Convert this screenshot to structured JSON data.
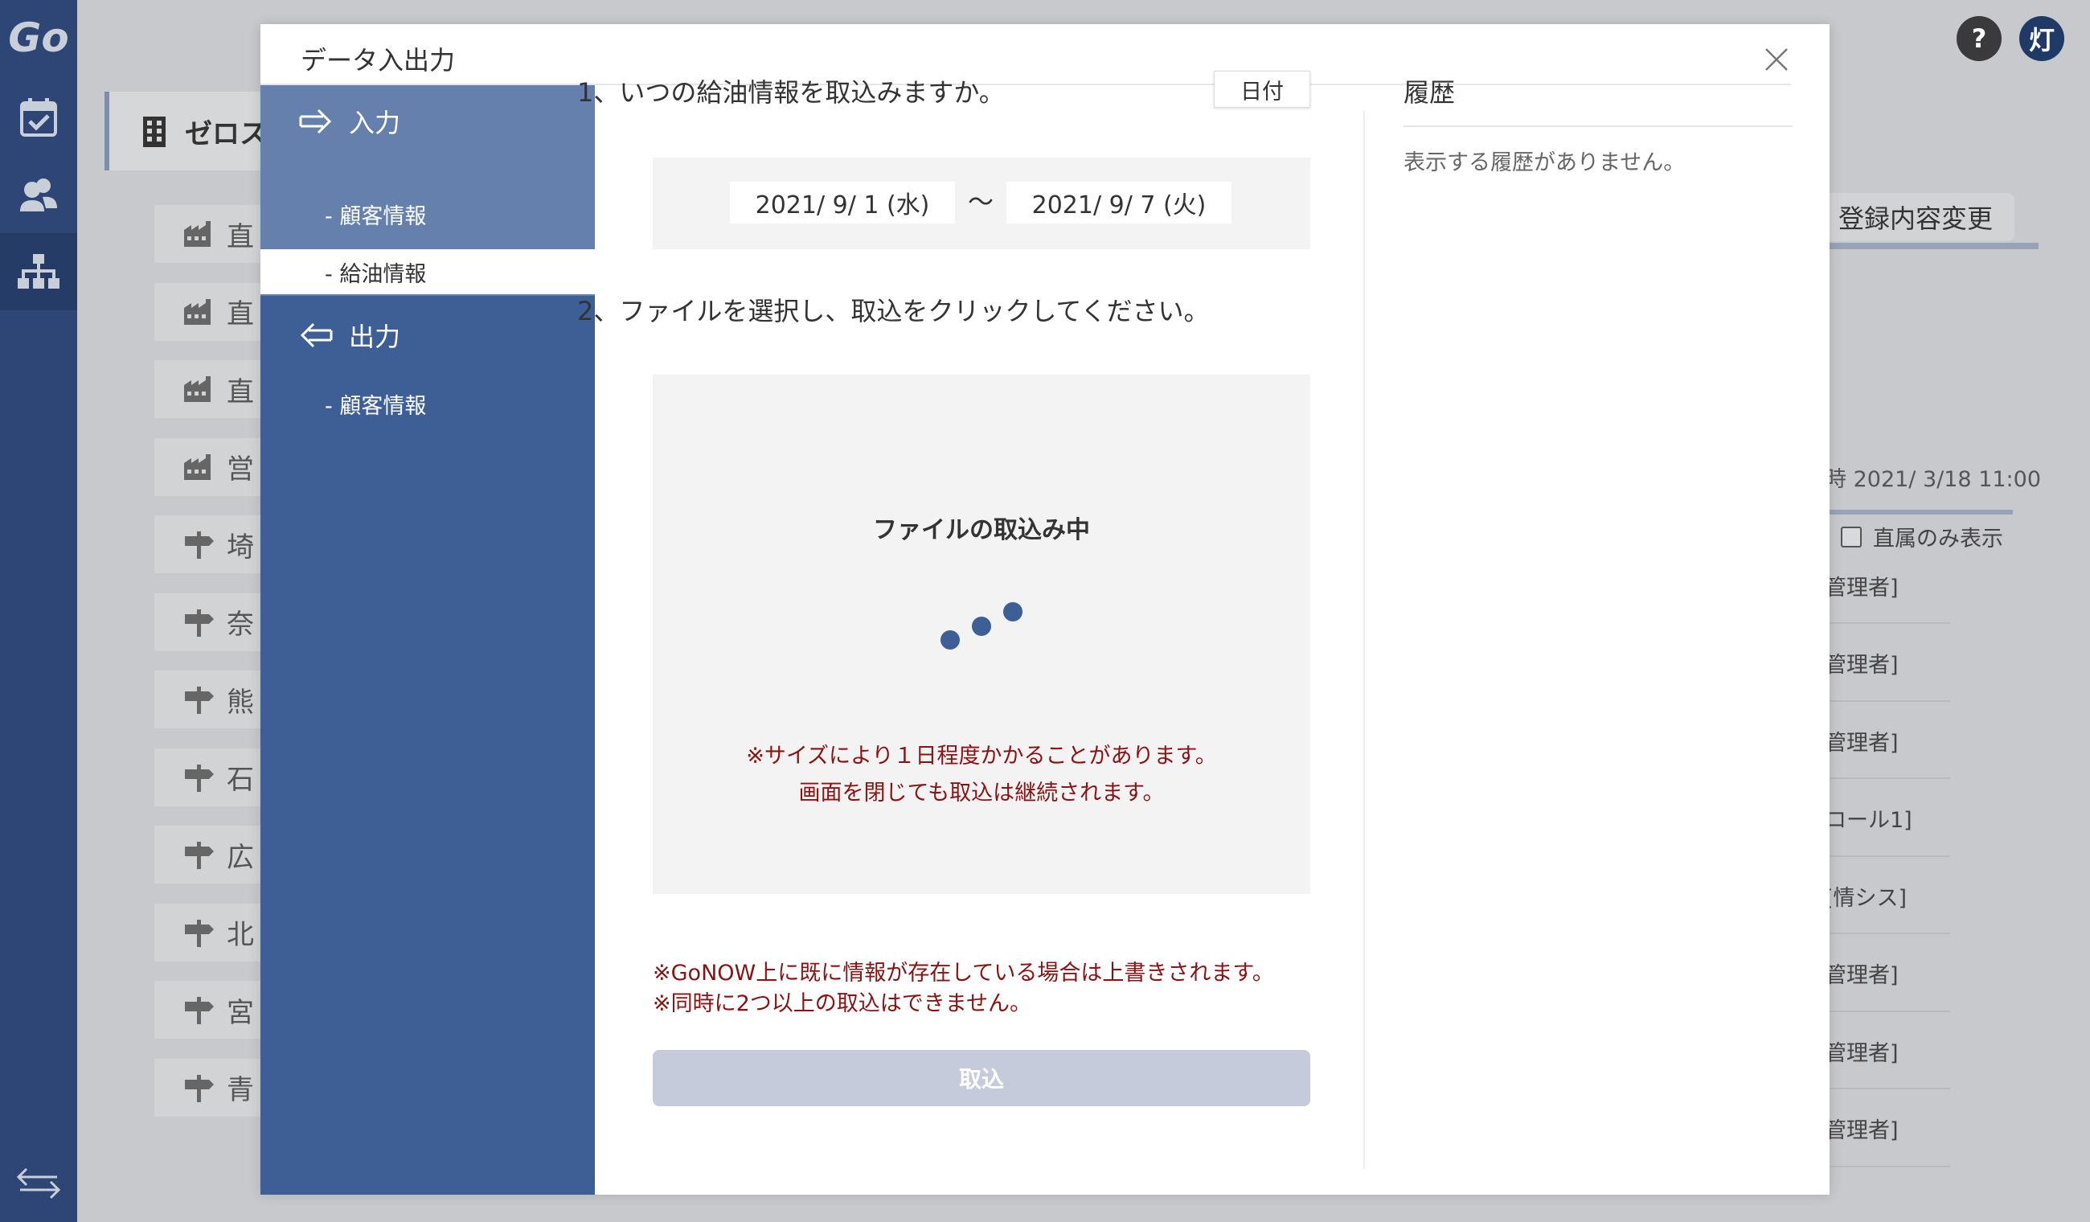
{
  "app": {
    "logo": "Go",
    "header_help": "?",
    "header_user_initial": "灯"
  },
  "background": {
    "org_title": "ゼロス",
    "org_rows": [
      {
        "icon": "factory-icon",
        "label": "直"
      },
      {
        "icon": "factory-icon",
        "label": "直"
      },
      {
        "icon": "factory-icon",
        "label": "直"
      },
      {
        "icon": "factory-icon",
        "label": "営"
      },
      {
        "icon": "signpost-icon",
        "label": "埼"
      },
      {
        "icon": "signpost-icon",
        "label": "奈"
      },
      {
        "icon": "signpost-icon",
        "label": "熊"
      },
      {
        "icon": "signpost-icon",
        "label": "石"
      },
      {
        "icon": "signpost-icon",
        "label": "広"
      },
      {
        "icon": "signpost-icon",
        "label": "北"
      },
      {
        "icon": "signpost-icon",
        "label": "宮"
      },
      {
        "icon": "signpost-icon",
        "label": "青"
      }
    ],
    "edit_button": "登録内容変更",
    "timestamp": "時 2021/ 3/18 11:00",
    "direct_only_label": "直属のみ表示",
    "roles": [
      "管理者]",
      "管理者]",
      "管理者]",
      "ロール1]",
      "[情シス]",
      "管理者]",
      "管理者]",
      "管理者]"
    ]
  },
  "modal": {
    "title": "データ入出力",
    "nav": {
      "input_label": "入力",
      "input_items": [
        "- 顧客情報",
        "- 給油情報"
      ],
      "output_label": "出力",
      "output_items": [
        "- 顧客情報"
      ]
    },
    "step1": "1、いつの給油情報を取込みますか。",
    "date_type_button": "日付",
    "date_from": "2021/ 9/ 1 (水)",
    "date_to": "2021/ 9/ 7 (火)",
    "date_separator": "〜",
    "step2": "2、ファイルを選択し、取込をクリックしてください。",
    "loading_title": "ファイルの取込み中",
    "loading_note_1": "※サイズにより１日程度かかることがあります。",
    "loading_note_2": "画面を閉じても取込は継続されます。",
    "overwrite_note": "※GoNOW上に既に情報が存在している場合は上書きされます。",
    "concurrent_note": "※同時に2つ以上の取込はできません。",
    "import_button": "取込",
    "history_title": "履歴",
    "history_empty": "表示する履歴がありません。"
  },
  "colors": {
    "rail": "#2d4675",
    "sidenav": "#3d5f95",
    "sidenav_active_block": "#6580ad",
    "warning_text": "#8b1212",
    "disabled_button": "#c5cbdb",
    "spinner": "#3d5f95"
  }
}
